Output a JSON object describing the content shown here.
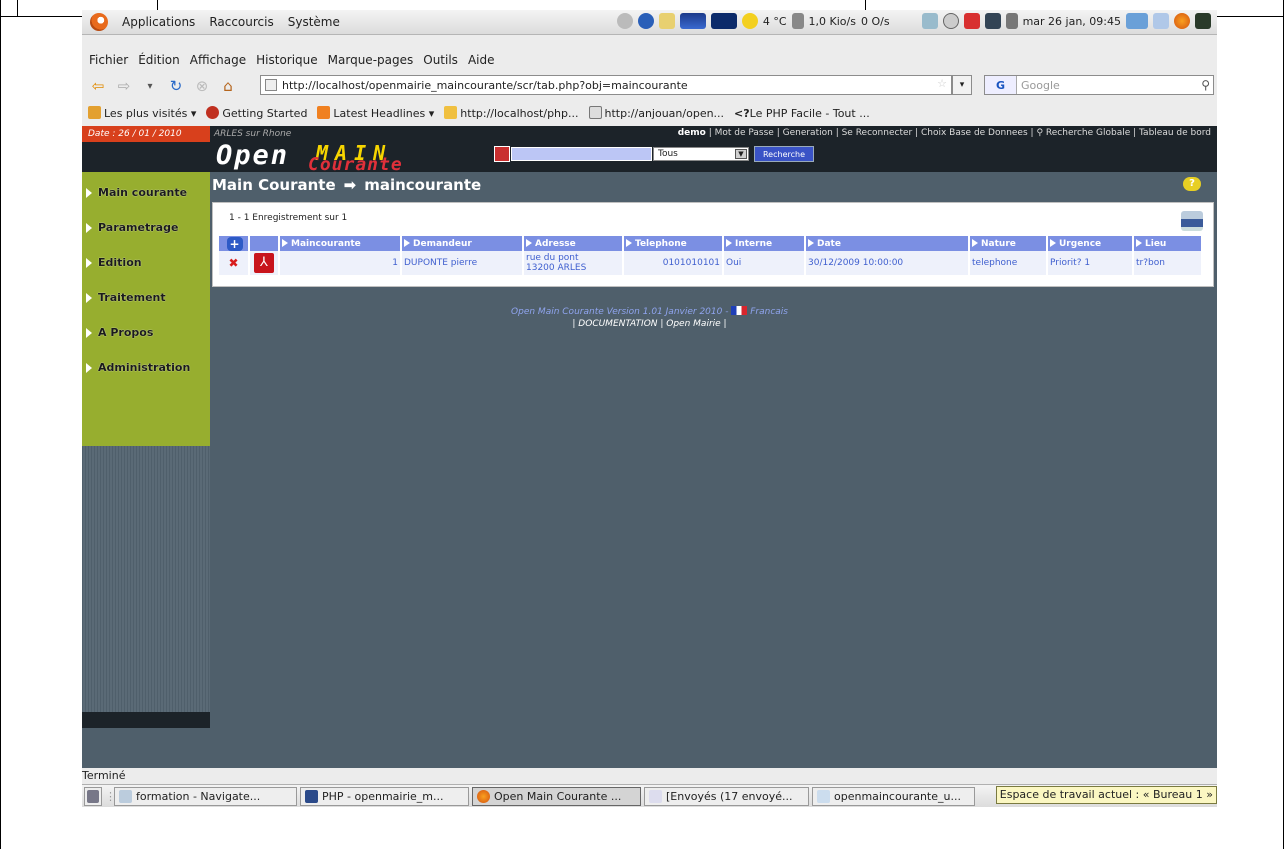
{
  "gnome_panel": {
    "menus": [
      "Applications",
      "Raccourcis",
      "Système"
    ],
    "weather": "4 °C",
    "net_down": "1,0 Kio/s",
    "net_up": "0 O/s",
    "clock": "mar 26 jan, 09:45"
  },
  "browser": {
    "menu": [
      "Fichier",
      "Édition",
      "Affichage",
      "Historique",
      "Marque-pages",
      "Outils",
      "Aide"
    ],
    "url": "http://localhost/openmairie_maincourante/scr/tab.php?obj=maincourante",
    "search_engine": "G",
    "search_placeholder": "Google",
    "bookmarks": [
      "Les plus visités",
      "Getting Started",
      "Latest Headlines",
      "http://localhost/php...",
      "http://anjouan/open...",
      "Le PHP Facile - Tout ..."
    ],
    "status": "Terminé"
  },
  "app": {
    "date": "Date : 26 / 01 / 2010",
    "city": "ARLES sur Rhone",
    "top_links": [
      "demo",
      "Mot de Passe",
      "Generation",
      "Se Reconnecter",
      "Choix Base de Donnees",
      "Recherche Globale",
      "Tableau de bord"
    ],
    "logo_open": "Open",
    "logo_main": "MAIN",
    "logo_courante": "Courante",
    "search_select": "Tous",
    "search_button": "Recherche",
    "sidebar": [
      "Main courante",
      "Parametrage",
      "Edition",
      "Traitement",
      "A Propos",
      "Administration"
    ],
    "crumb_title": "Main Courante",
    "crumb_sub": "maincourante",
    "record_count": "1 - 1 Enregistrement sur 1",
    "columns": [
      "Maincourante",
      "Demandeur",
      "Adresse",
      "Telephone",
      "Interne",
      "Date",
      "Nature",
      "Urgence",
      "Lieu"
    ],
    "row": {
      "maincourante": "1",
      "demandeur": "DUPONTE pierre",
      "adresse_1": "rue du pont",
      "adresse_2": "13200 ARLES",
      "telephone": "0101010101",
      "interne": "Oui",
      "date": "30/12/2009 10:00:00",
      "nature": "telephone",
      "urgence": "Priorit? 1",
      "lieu": "tr?bon"
    },
    "footer_line1": "Open Main Courante  Version 1.01 Janvier 2010 -",
    "footer_lang": "Francais",
    "footer_doc": "| DOCUMENTATION | Open Mairie |"
  },
  "taskbar": {
    "tasks": [
      "formation - Navigate...",
      "PHP - openmairie_m...",
      "Open Main Courante ...",
      "[Envoyés (17 envoyé...",
      "openmaincourante_u..."
    ],
    "tooltip": "Espace de travail actuel : « Bureau 1 »"
  }
}
